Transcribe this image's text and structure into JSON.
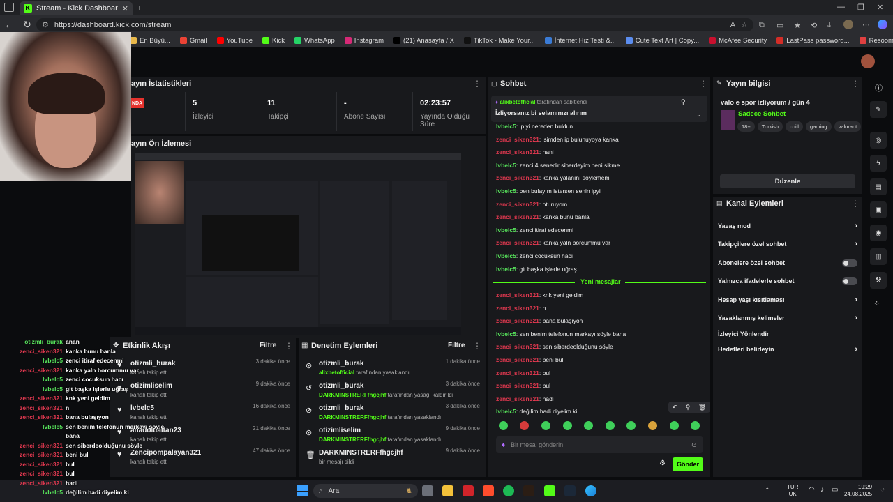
{
  "browser": {
    "tab_title": "Stream - Kick Dashboard",
    "url": "https://dashboard.kick.com/stream",
    "bookmarks": [
      {
        "label": "En Büyü...",
        "color": "#e8b84a"
      },
      {
        "label": "Gmail",
        "color": "#ea4335"
      },
      {
        "label": "YouTube",
        "color": "#ff0000"
      },
      {
        "label": "Kick",
        "color": "#53fc18"
      },
      {
        "label": "WhatsApp",
        "color": "#25d366"
      },
      {
        "label": "Instagram",
        "color": "#d62976"
      },
      {
        "label": "(21) Anasayfa / X",
        "color": "#000000"
      },
      {
        "label": "TikTok - Make Your...",
        "color": "#111111"
      },
      {
        "label": "İnternet Hız Testi &...",
        "color": "#3a7bd5"
      },
      {
        "label": "Cute Text Art | Copy...",
        "color": "#5b8def"
      },
      {
        "label": "McAfee Security",
        "color": "#c8102e"
      },
      {
        "label": "LastPass password...",
        "color": "#d32d27"
      },
      {
        "label": "Resoomer | Çevrimi...",
        "color": "#e04040"
      }
    ]
  },
  "stats": {
    "title": "ayın İstatistikleri",
    "live_badge": "NDA",
    "items": [
      {
        "value": "5",
        "label": "İzleyici"
      },
      {
        "value": "11",
        "label": "Takipçi"
      },
      {
        "value": "-",
        "label": "Abone Sayısı"
      },
      {
        "value": "02:23:57",
        "label": "Yayında Olduğu Süre"
      }
    ]
  },
  "preview": {
    "title": "ayın Ön İzlemesi"
  },
  "activity": {
    "title": "Etkinlik Akışı",
    "filter": "Filtre",
    "rows": [
      {
        "name": "otizmli_burak",
        "sub": "kanalı takip etti",
        "time": "3 dakika önce"
      },
      {
        "name": "otizimliselim",
        "sub": "kanalı takip etti",
        "time": "9 dakika önce"
      },
      {
        "name": "lvbelc5",
        "sub": "kanalı takip etti",
        "time": "16 dakika önce"
      },
      {
        "name": "anadolualtan23",
        "sub": "kanalı takip etti",
        "time": "21 dakika önce"
      },
      {
        "name": "Zencipompalayan321",
        "sub": "kanalı takip etti",
        "time": "47 dakika önce"
      }
    ]
  },
  "moderation": {
    "title": "Denetim Eylemleri",
    "filter": "Filtre",
    "rows": [
      {
        "name": "otizmli_burak",
        "actor": "alixbetofficial",
        "sub": "tarafından yasaklandı",
        "time": "1 dakika önce"
      },
      {
        "name": "otizmli_burak",
        "actor": "DARKMINSTRERFfhgcjhf",
        "sub": "tarafından yasağı kaldırıldı",
        "time": "3 dakika önce"
      },
      {
        "name": "otizmli_burak",
        "actor": "DARKMINSTRERFfhgcjhf",
        "sub": "tarafından yasaklandı",
        "time": "3 dakika önce"
      },
      {
        "name": "otizimliselim",
        "actor": "DARKMINSTRERFfhgcjhf",
        "sub": "tarafından yasaklandı",
        "time": "9 dakika önce"
      },
      {
        "name": "DARKMINSTRERFfhgcjhf",
        "actor": "",
        "sub": "bir mesajı sildi",
        "time": "9 dakika önce"
      }
    ]
  },
  "chat": {
    "title": "Sohbet",
    "pinned_by": "alixbetofficial",
    "pinned_by_suffix": "tarafından sabitlendi",
    "pinned_text": "İzliyorsanız bi selamınızı alırım",
    "messages_before": [
      {
        "user": "lvbelc5",
        "color": "u2",
        "text": ": ip yi nereden buldun"
      },
      {
        "user": "zenci_siken321",
        "color": "u1",
        "text": ": isimden ip bulunuyoya kanka"
      },
      {
        "user": "zenci_siken321",
        "color": "u1",
        "text": ": hani"
      },
      {
        "user": "lvbelc5",
        "color": "u2",
        "text": ": zenci 4 senedir siberdeyim beni sikme"
      },
      {
        "user": "zenci_siken321",
        "color": "u1",
        "text": ": kanka yalanını söylemem"
      },
      {
        "user": "lvbelc5",
        "color": "u2",
        "text": ": ben bulayım istersen senin ipyi"
      },
      {
        "user": "zenci_siken321",
        "color": "u1",
        "text": ": oturuyom"
      },
      {
        "user": "zenci_siken321",
        "color": "u1",
        "text": ": kanka bunu banla"
      },
      {
        "user": "lvbelc5",
        "color": "u2",
        "text": ": zenci itiraf edecenmi"
      },
      {
        "user": "zenci_siken321",
        "color": "u1",
        "text": ": kanka yaln borcummu var"
      },
      {
        "user": "lvbelc5",
        "color": "u2",
        "text": ": zenci cocuksun hacı"
      },
      {
        "user": "lvbelc5",
        "color": "u2",
        "text": ": git başka işlerle uğraş"
      }
    ],
    "new_messages": "Yeni mesajlar",
    "messages_after": [
      {
        "user": "zenci_siken321",
        "color": "u1",
        "text": ": knk yeni geldim"
      },
      {
        "user": "zenci_siken321",
        "color": "u1",
        "text": ": n"
      },
      {
        "user": "zenci_siken321",
        "color": "u1",
        "text": ": bana bulaşıyon"
      },
      {
        "user": "lvbelc5",
        "color": "u2",
        "text": ": sen benim telefonun markayı söyle bana"
      },
      {
        "user": "zenci_siken321",
        "color": "u1",
        "text": ": sen siberdeolduğunu söyle"
      },
      {
        "user": "zenci_siken321",
        "color": "u1",
        "text": ": beni bul"
      },
      {
        "user": "zenci_siken321",
        "color": "u1",
        "text": ": bul"
      },
      {
        "user": "zenci_siken321",
        "color": "u1",
        "text": ": bul"
      },
      {
        "user": "zenci_siken321",
        "color": "u1",
        "text": ": hadi"
      },
      {
        "user": "lvbelc5",
        "color": "u2",
        "text": ": değilim hadi diyelim ki"
      }
    ],
    "input_placeholder": "Bir mesaj gönderin",
    "send_label": "Gönder"
  },
  "stream_info": {
    "title": "Yayın bilgisi",
    "stream_title": "valo e spor izliyorum / gün 4",
    "category": "Sadece Sohbet",
    "tags": [
      "18+",
      "Turkish",
      "chill",
      "gaming",
      "valorant"
    ],
    "edit_label": "Düzenle"
  },
  "channel_actions": {
    "title": "Kanal Eylemleri",
    "items": [
      {
        "label": "Yavaş mod",
        "control": "chevron"
      },
      {
        "label": "Takipçilere özel sohbet",
        "control": "chevron"
      },
      {
        "label": "Abonelere özel sohbet",
        "control": "toggle"
      },
      {
        "label": "Yalnızca ifadelerle sohbet",
        "control": "toggle"
      },
      {
        "label": "Hesap yaşı kısıtlaması",
        "control": "chevron"
      },
      {
        "label": "Yasaklanmış kelimeler",
        "control": "chevron"
      },
      {
        "label": "İzleyici Yönlendir",
        "control": "none"
      },
      {
        "label": "Hedefleri belirleyin",
        "control": "chevron"
      }
    ]
  },
  "overlay_chat": [
    {
      "user": "otizmli_burak",
      "color": "#57e35b",
      "text": "anan"
    },
    {
      "user": "zenci_siken321",
      "color": "#e0384f",
      "text": "kanka bunu banla"
    },
    {
      "user": "lvbelc5",
      "color": "#57e35b",
      "text": "zenci itiraf edecenmi"
    },
    {
      "user": "zenci_siken321",
      "color": "#e0384f",
      "text": "kanka yaln borcummu var"
    },
    {
      "user": "lvbelc5",
      "color": "#57e35b",
      "text": "zenci cocuksun hacı"
    },
    {
      "user": "lvbelc5",
      "color": "#57e35b",
      "text": "git başka işlerle uğraş"
    },
    {
      "user": "zenci_siken321",
      "color": "#e0384f",
      "text": "knk yeni geldim"
    },
    {
      "user": "zenci_siken321",
      "color": "#e0384f",
      "text": "n"
    },
    {
      "user": "zenci_siken321",
      "color": "#e0384f",
      "text": "bana bulaşıyon"
    },
    {
      "user": "lvbelc5",
      "color": "#57e35b",
      "text": "sen benim telefonun markayı söyle"
    },
    {
      "user": "",
      "color": "#57e35b",
      "text": "bana"
    },
    {
      "user": "zenci_siken321",
      "color": "#e0384f",
      "text": "sen siberdeolduğunu söyle"
    },
    {
      "user": "zenci_siken321",
      "color": "#e0384f",
      "text": "beni bul"
    },
    {
      "user": "zenci_siken321",
      "color": "#e0384f",
      "text": "bul"
    },
    {
      "user": "zenci_siken321",
      "color": "#e0384f",
      "text": "bul"
    },
    {
      "user": "zenci_siken321",
      "color": "#e0384f",
      "text": "hadi"
    },
    {
      "user": "lvbelc5",
      "color": "#57e35b",
      "text": "değilim hadi diyelim ki"
    }
  ],
  "taskbar": {
    "search": "Ara",
    "lang": "TUR",
    "lang2": "UK",
    "time": "19:29",
    "date": "24.08.2025"
  },
  "colors": {
    "accent": "#53fc18",
    "user_red": "#e0384f",
    "user_green": "#57e35b"
  }
}
